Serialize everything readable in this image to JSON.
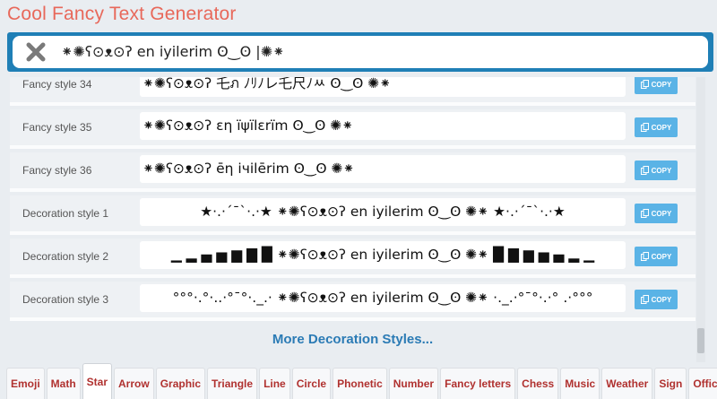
{
  "app": {
    "title": "Cool Fancy Text Generator"
  },
  "search": {
    "value": "⁕✺ʕ⊙ᴥ⊙ʔ en iyilerim ʘ‿ʘ |✺⁕"
  },
  "rows": [
    {
      "label": "Fancy style 34",
      "text": "⁕✺ʕ⊙ᴥ⊙ʔ 乇ภ ﾉﾘﾉレ乇尺ﾉﾶ ʘ‿ʘ ✺⁕",
      "copy": "COPY"
    },
    {
      "label": "Fancy style 35",
      "text": "⁕✺ʕ⊙ᴥ⊙ʔ εη ïψïlεrïm ʘ‿ʘ ✺⁕",
      "copy": "COPY"
    },
    {
      "label": "Fancy style 36",
      "text": "⁕✺ʕ⊙ᴥ⊙ʔ ēη iчilērim ʘ‿ʘ ✺⁕",
      "copy": "COPY"
    },
    {
      "label": "Decoration style 1",
      "text": "★·.·´¯`·.·★ ⁕✺ʕ⊙ᴥ⊙ʔ en iyilerim ʘ‿ʘ ✺⁕ ★·.·´¯`·.·★",
      "copy": "COPY"
    },
    {
      "label": "Decoration style 2",
      "text": "▁ ▂ ▄ ▅ ▆ ▇ █ ⁕✺ʕ⊙ᴥ⊙ʔ en iyilerim ʘ‿ʘ ✺⁕ █ ▇ ▆ ▅ ▄ ▂ ▁",
      "copy": "COPY"
    },
    {
      "label": "Decoration style 3",
      "text": "°°°·.°·..·°¯°·._.· ⁕✺ʕ⊙ᴥ⊙ʔ en iyilerim ʘ‿ʘ ✺⁕ ·._.·°¯°·.·° .·°°°",
      "copy": "COPY"
    }
  ],
  "more_link": "More Decoration Styles...",
  "tabs": [
    "Emoji",
    "Math",
    "Star",
    "Arrow",
    "Graphic",
    "Triangle",
    "Line",
    "Circle",
    "Phonetic",
    "Number",
    "Fancy letters",
    "Chess",
    "Music",
    "Weather",
    "Sign",
    "Office"
  ],
  "active_tab": "Star",
  "colors": {
    "title": "#e8685a",
    "search_frame": "#1f7fb6",
    "copy_button": "#5ab3e6",
    "tab_text": "#b0312f",
    "link": "#2b7bb5"
  }
}
